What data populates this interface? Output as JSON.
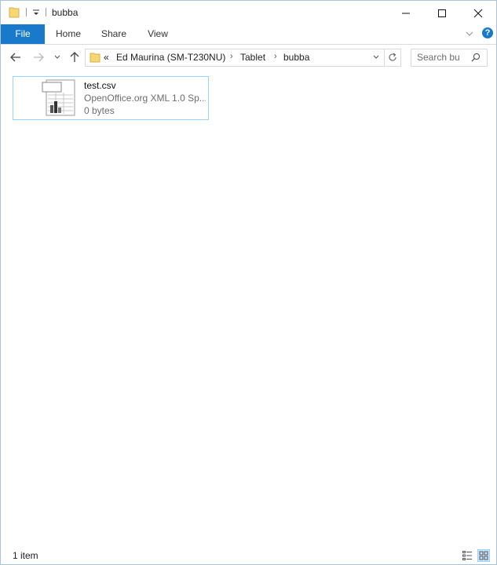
{
  "window": {
    "title": "bubba"
  },
  "ribbon": {
    "tabs": [
      {
        "label": "File"
      },
      {
        "label": "Home"
      },
      {
        "label": "Share"
      },
      {
        "label": "View"
      }
    ],
    "help_label": "?"
  },
  "address": {
    "overflow": "«",
    "parts": [
      "Ed Maurina (SM-T230NU)",
      "Tablet",
      "bubba"
    ]
  },
  "search": {
    "placeholder": "Search bu"
  },
  "files": [
    {
      "name": "test.csv",
      "type": "OpenOffice.org XML 1.0 Sp...",
      "size": "0 bytes",
      "icon": "spreadsheet-file-icon"
    }
  ],
  "status": {
    "item_count": "1 item"
  },
  "colors": {
    "accent": "#1979ca",
    "selection_border": "#99d1ff"
  }
}
